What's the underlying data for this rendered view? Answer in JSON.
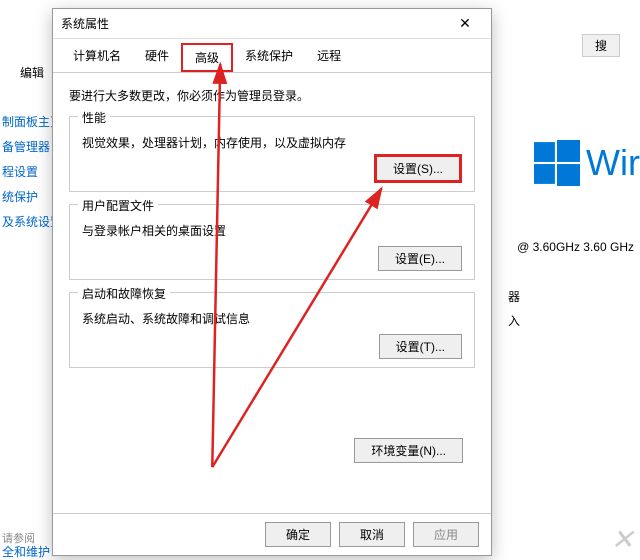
{
  "background": {
    "edit_label": "编辑",
    "sidebar_items": [
      "制面板主页",
      "备管理器",
      "程设置",
      "统保护",
      "及系统设置"
    ],
    "footer_hint": "请参阅",
    "footer_link": "全和维护",
    "search_btn": "搜",
    "win_text": "Wir",
    "ghz": "@ 3.60GHz   3.60 GHz",
    "right_label1": "器",
    "right_label2": "入"
  },
  "dialog": {
    "title": "系统属性",
    "tabs": [
      "计算机名",
      "硬件",
      "高级",
      "系统保护",
      "远程"
    ],
    "active_tab": 2,
    "admin_note": "要进行大多数更改，你必须作为管理员登录。",
    "groups": [
      {
        "title": "性能",
        "desc": "视觉效果，处理器计划，内存使用，以及虚拟内存",
        "btn": "设置(S)...",
        "hl": true
      },
      {
        "title": "用户配置文件",
        "desc": "与登录帐户相关的桌面设置",
        "btn": "设置(E)...",
        "hl": false
      },
      {
        "title": "启动和故障恢复",
        "desc": "系统启动、系统故障和调试信息",
        "btn": "设置(T)...",
        "hl": false
      }
    ],
    "env_btn": "环境变量(N)...",
    "footer": {
      "ok": "确定",
      "cancel": "取消",
      "apply": "应用"
    }
  }
}
